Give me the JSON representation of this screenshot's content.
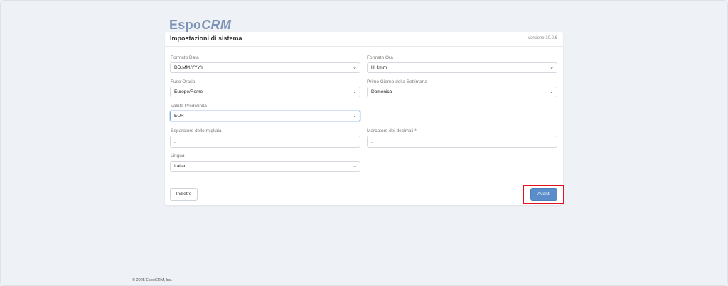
{
  "brand": {
    "logo_part1": "Espo",
    "logo_part2": "CRM"
  },
  "panel": {
    "title": "Impostazioni di sistema",
    "version": "Versione 10.0.6"
  },
  "fields": {
    "date_format": {
      "label": "Formato Data",
      "value": "DD.MM.YYYY"
    },
    "time_format": {
      "label": "Formato Ora",
      "value": "HH:mm"
    },
    "timezone": {
      "label": "Fuso Orario",
      "value": "Europe/Rome"
    },
    "week_start": {
      "label": "Primo Giorno della Settimana",
      "value": "Domenica"
    },
    "currency": {
      "label": "Valuta Predefinita",
      "value": "EUR"
    },
    "thousand_separator": {
      "label": "Separatore delle migliaia",
      "value": "."
    },
    "decimal_mark": {
      "label": "Marcatore dei decimali *",
      "value": ","
    },
    "language": {
      "label": "Lingua",
      "value": "Italian"
    }
  },
  "buttons": {
    "back": "Indietro",
    "next": "Avanti"
  },
  "footer": {
    "copyright": "© 2025 EspoCRM, Inc."
  },
  "colors": {
    "primary": "#5a8dc9",
    "highlight": "#e0141e",
    "background": "#eef1f5"
  },
  "icons": {
    "select": "chevron-down-icon"
  }
}
